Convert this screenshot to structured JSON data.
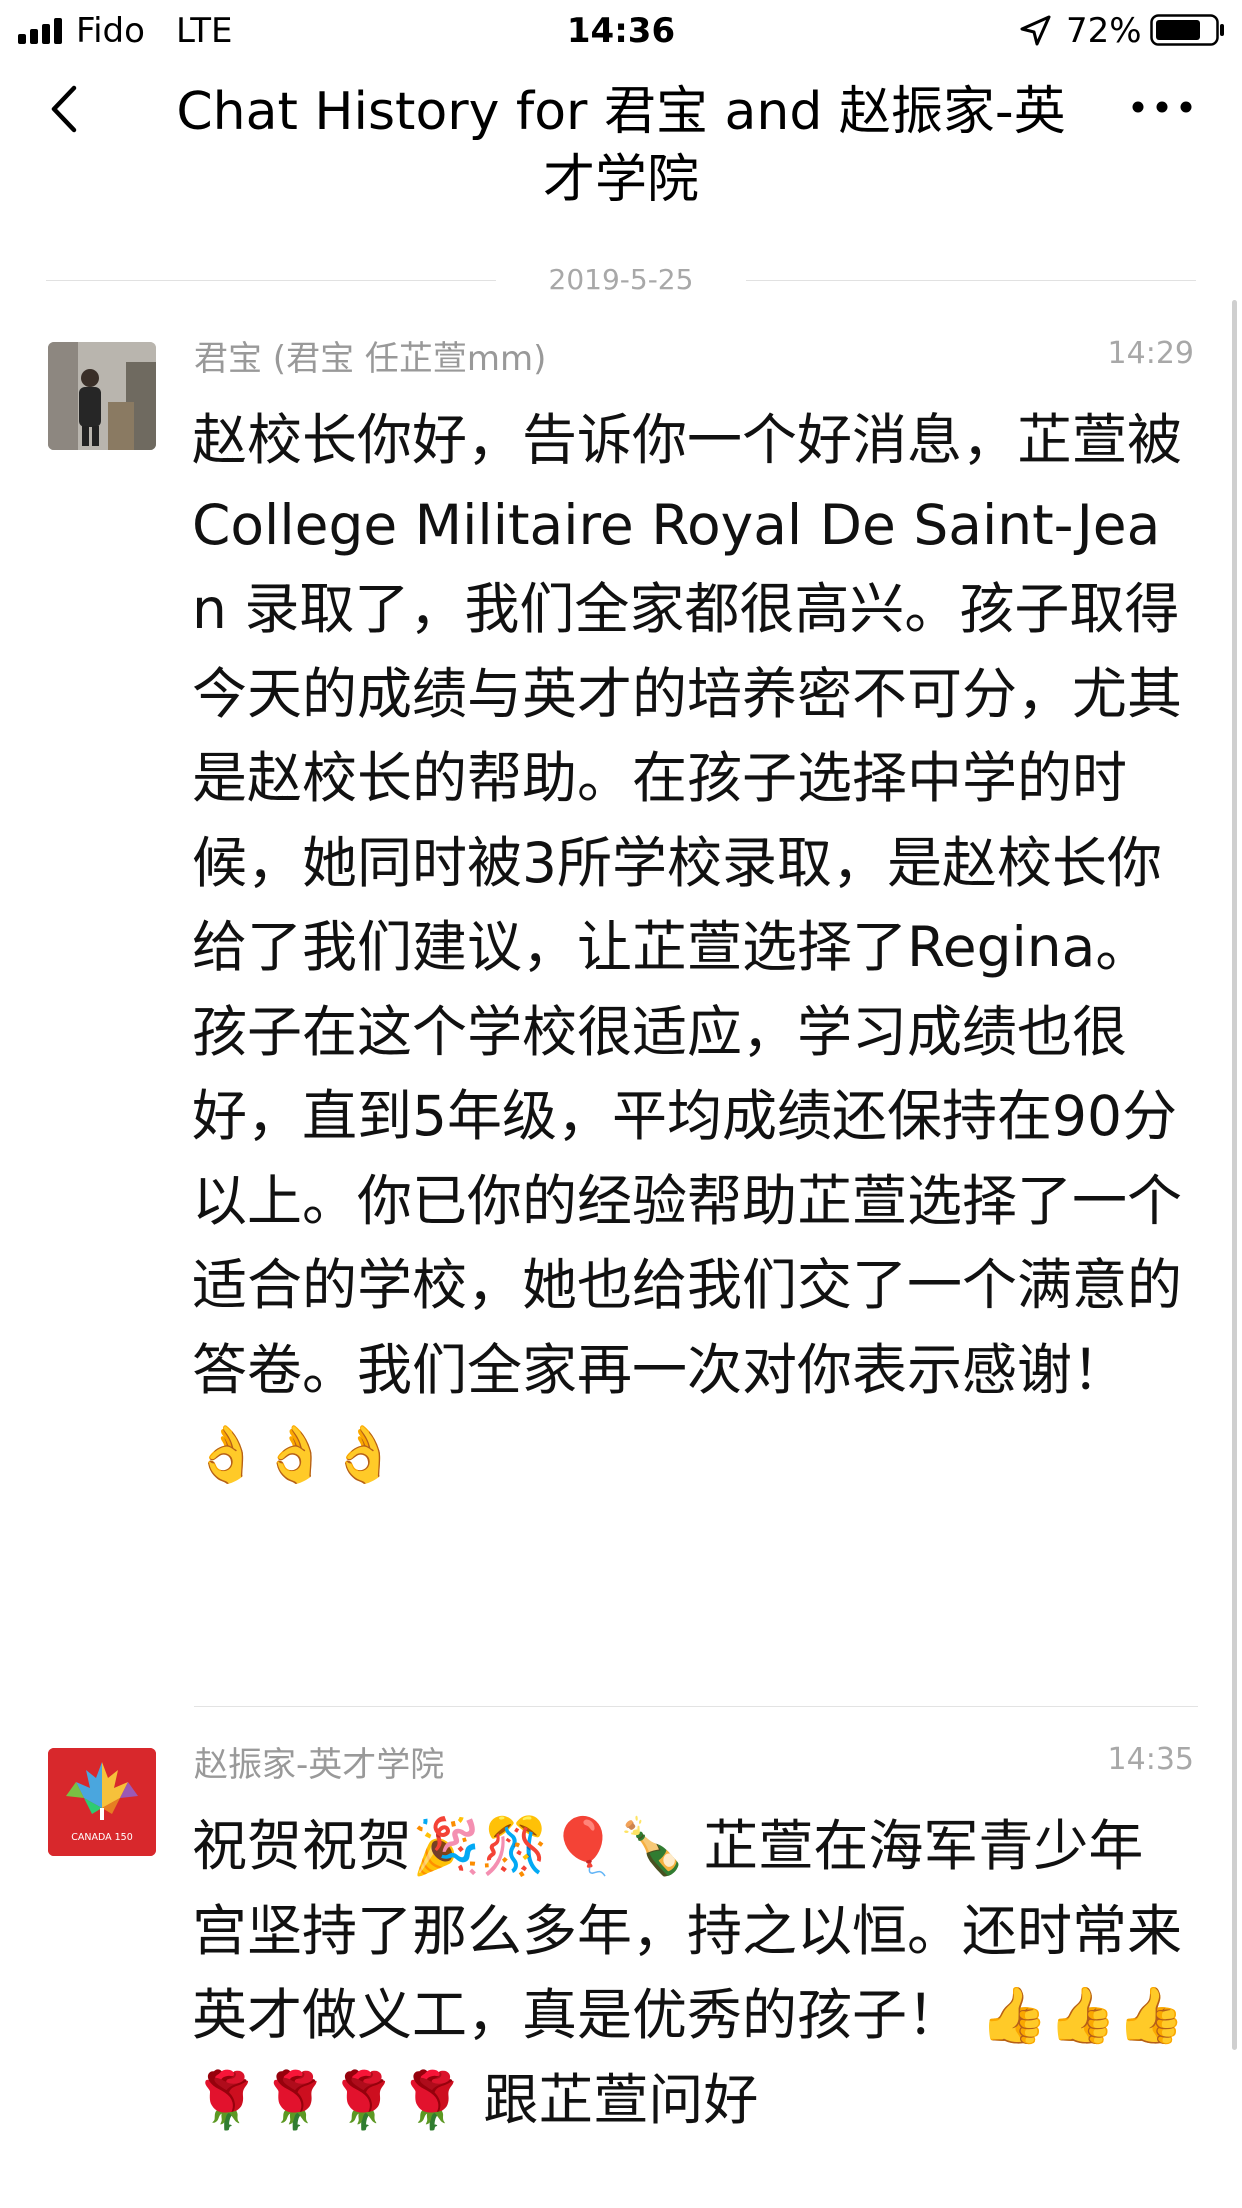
{
  "status_bar": {
    "carrier": "Fido",
    "network": "LTE",
    "time": "14:36",
    "battery": "72%",
    "icons": [
      "signal-icon",
      "location-arrow-icon",
      "battery-icon"
    ]
  },
  "nav": {
    "title": "Chat History for 君宝 and 赵振家-英才学院",
    "back_icon": "chevron-left-icon",
    "more_icon": "more-dots-icon"
  },
  "date_separator": "2019-5-25",
  "messages": [
    {
      "sender": "君宝 (君宝 任芷萱mm)",
      "time": "14:29",
      "text": "赵校长你好，告诉你一个好消息，芷萱被College Militaire Royal De Saint-Jean 录取了，我们全家都很高兴。孩子取得今天的成绩与英才的培养密不可分，尤其是赵校长的帮助。在孩子选择中学的时候，她同时被3所学校录取，是赵校长你给了我们建议，让芷萱选择了Regina。孩子在这个学校很适应，学习成绩也很好，直到5年级，平均成绩还保持在90分以上。你已你的经验帮助芷萱选择了一个适合的学校，她也给我们交了一个满意的答卷。我们全家再一次对你表示感谢！ 👌👌👌",
      "avatar": "user-photo-avatar"
    },
    {
      "sender": "赵振家-英才学院",
      "time": "14:35",
      "text": "祝贺祝贺🎉🎊🎈🍾 芷萱在海军青少年宫坚持了那么多年，持之以恒。还时常来英才做义工，真是优秀的孩子！ 👍👍👍🌹🌹🌹🌹 跟芷萱问好",
      "avatar": "canada-150-avatar",
      "avatar_label": "CANADA 150"
    }
  ],
  "colors": {
    "meta_gray": "#a8a8a8",
    "sender_gray": "#999999",
    "canada_red": "#d8282c"
  }
}
